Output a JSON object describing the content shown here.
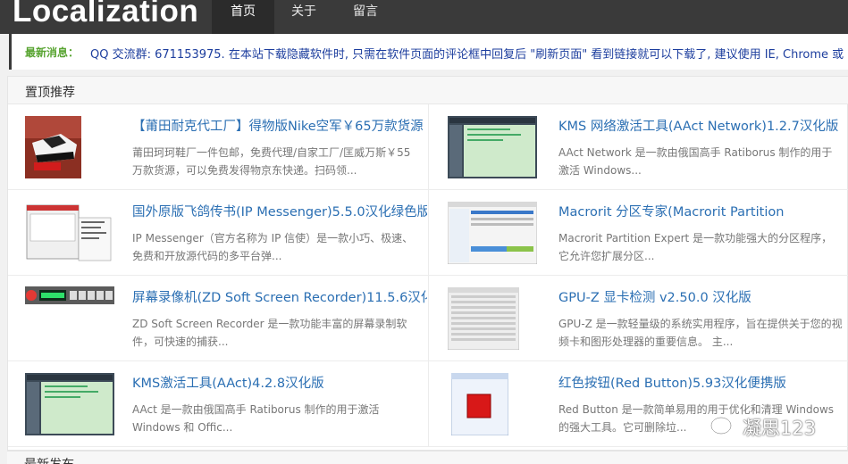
{
  "brand": {
    "logo_text": "Localization"
  },
  "nav": {
    "items": [
      {
        "label": "首页"
      },
      {
        "label": "关于"
      },
      {
        "label": "留言"
      }
    ]
  },
  "news": {
    "label": "最新消息：",
    "text": "QQ 交流群: 671153975.   在本站下载隐藏软件时, 只需在软件页面的评论框中回复后 \"刷新页面\" 看到链接就可以下载了, 建议使用 IE, Chrome 或 Fire"
  },
  "section": {
    "title": "置顶推荐"
  },
  "cards": [
    {
      "title": "【莆田耐克代工厂】得物版Nike空军￥65万款货源",
      "desc": "莆田珂珂鞋厂一件包邮，免费代理/自家工厂/匡威万斯￥55万款货源，可以免费发得物京东快递。扫码领...",
      "icon": "sneaker-photo"
    },
    {
      "title": "KMS 网络激活工具(AAct Network)1.2.7汉化版",
      "desc": "AAct Network 是一款由俄国高手 Ratiborus 制作的用于激活 Windows...",
      "icon": "app-window-screenshot"
    },
    {
      "title": "国外原版飞鸽传书(IP Messenger)5.5.0汉化绿色版",
      "desc": "IP Messenger（官方名称为 IP 信使）是一款小巧、极速、免费和开放源代码的多平台弹...",
      "icon": "dialog-screenshot"
    },
    {
      "title": "Macrorit 分区专家(Macrorit Partition",
      "desc": "Macrorit Partition Expert 是一款功能强大的分区程序，它允许您扩展分区...",
      "icon": "partition-screenshot"
    },
    {
      "title": "屏幕录像机(ZD Soft Screen Recorder)11.5.6汉化",
      "desc": "ZD Soft Screen Recorder 是一款功能丰富的屏幕录制软件，可快速的捕获...",
      "icon": "recorder-toolbar-screenshot"
    },
    {
      "title": "GPU-Z 显卡检测 v2.50.0 汉化版",
      "desc": "GPU-Z 是一款轻量级的系统实用程序，旨在提供关于您的视频卡和图形处理器的重要信息。 主...",
      "icon": "gpu-z-screenshot"
    },
    {
      "title": "KMS激活工具(AAct)4.2.8汉化版",
      "desc": "AAct 是一款由俄国高手 Ratiborus 制作的用于激活 Windows 和 Offic...",
      "icon": "app-window-screenshot"
    },
    {
      "title": "红色按钮(Red Button)5.93汉化便携版",
      "desc": "Red Button 是一款简单易用的用于优化和清理 Windows 的强大工具。它可删除垃...",
      "icon": "red-button-screenshot"
    }
  ],
  "next_section": {
    "title": "最新发布"
  },
  "watermark": {
    "text": "凝思123",
    "icon": "wechat-icon"
  }
}
